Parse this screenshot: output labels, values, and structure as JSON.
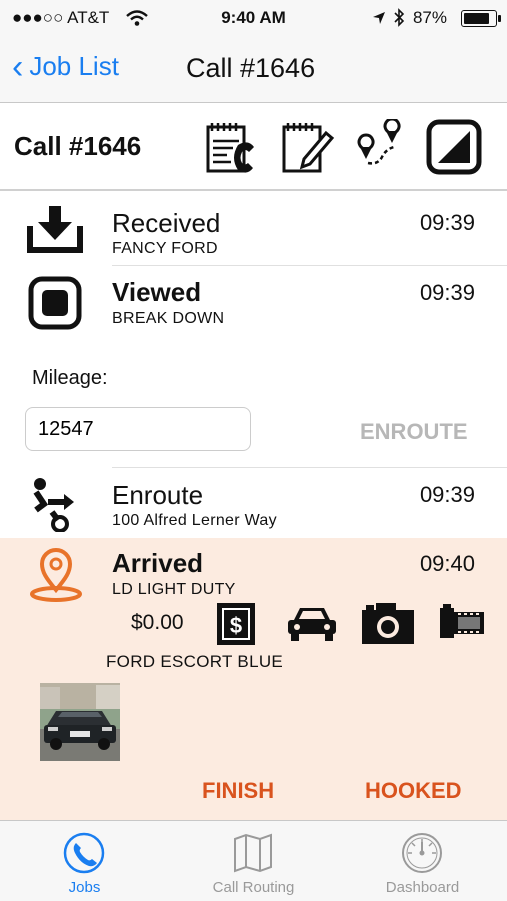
{
  "status_bar": {
    "carrier": "●●●○○ AT&T",
    "time": "9:40 AM",
    "battery": "87%"
  },
  "nav": {
    "back_label": "Job List",
    "title": "Call #1646"
  },
  "toolbar": {
    "title": "Call #1646",
    "icons": [
      "notes-phone-icon",
      "edit-note-icon",
      "route-pins-icon",
      "contrast-square-icon"
    ]
  },
  "events": [
    {
      "title": "Received",
      "subtitle": "FANCY FORD",
      "time": "09:39"
    },
    {
      "title": "Viewed",
      "subtitle": "BREAK DOWN",
      "time": "09:39"
    },
    {
      "title": "Enroute",
      "subtitle": "100 Alfred Lerner Way",
      "time": "09:39"
    },
    {
      "title": "Arrived",
      "subtitle": "LD LIGHT DUTY",
      "time": "09:40"
    }
  ],
  "mileage": {
    "label": "Mileage:",
    "value": "12547",
    "enroute_button": "ENROUTE"
  },
  "arrived": {
    "amount": "$0.00",
    "vehicle": "FORD ESCORT  BLUE",
    "finish_button": "FINISH",
    "hooked_button": "HOOKED",
    "accent_color": "#d9531e"
  },
  "tabs": [
    {
      "label": "Jobs",
      "icon": "phone-circle-icon",
      "active": true
    },
    {
      "label": "Call Routing",
      "icon": "map-icon",
      "active": false
    },
    {
      "label": "Dashboard",
      "icon": "gauge-icon",
      "active": false
    }
  ],
  "colors": {
    "brand_blue": "#1a7ef0",
    "arrived_bg": "#fcebe0",
    "disabled_text": "#b7b7b7"
  }
}
